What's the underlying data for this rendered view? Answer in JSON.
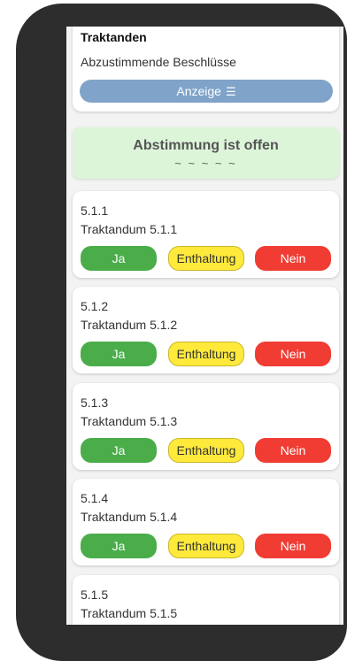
{
  "header": {
    "title": "Traktanden",
    "subtitle": "Abzustimmende Beschlüsse",
    "show_button_label": "Anzeige",
    "show_button_icon": "list-icon"
  },
  "status": {
    "title": "Abstimmung ist offen",
    "subtitle": "~ ~ ~ ~ ~"
  },
  "vote_labels": {
    "yes": "Ja",
    "abstain": "Enthaltung",
    "no": "Nein"
  },
  "colors": {
    "yes": "#4aad4a",
    "abstain": "#ffea3b",
    "no": "#f03c32",
    "status_bg": "#dcf5d9",
    "show_button": "#7fa3c9"
  },
  "items": [
    {
      "number": "5.1.1",
      "title": "Traktandum 5.1.1"
    },
    {
      "number": "5.1.2",
      "title": "Traktandum 5.1.2"
    },
    {
      "number": "5.1.3",
      "title": "Traktandum 5.1.3"
    },
    {
      "number": "5.1.4",
      "title": "Traktandum 5.1.4"
    },
    {
      "number": "5.1.5",
      "title": "Traktandum 5.1.5"
    }
  ]
}
